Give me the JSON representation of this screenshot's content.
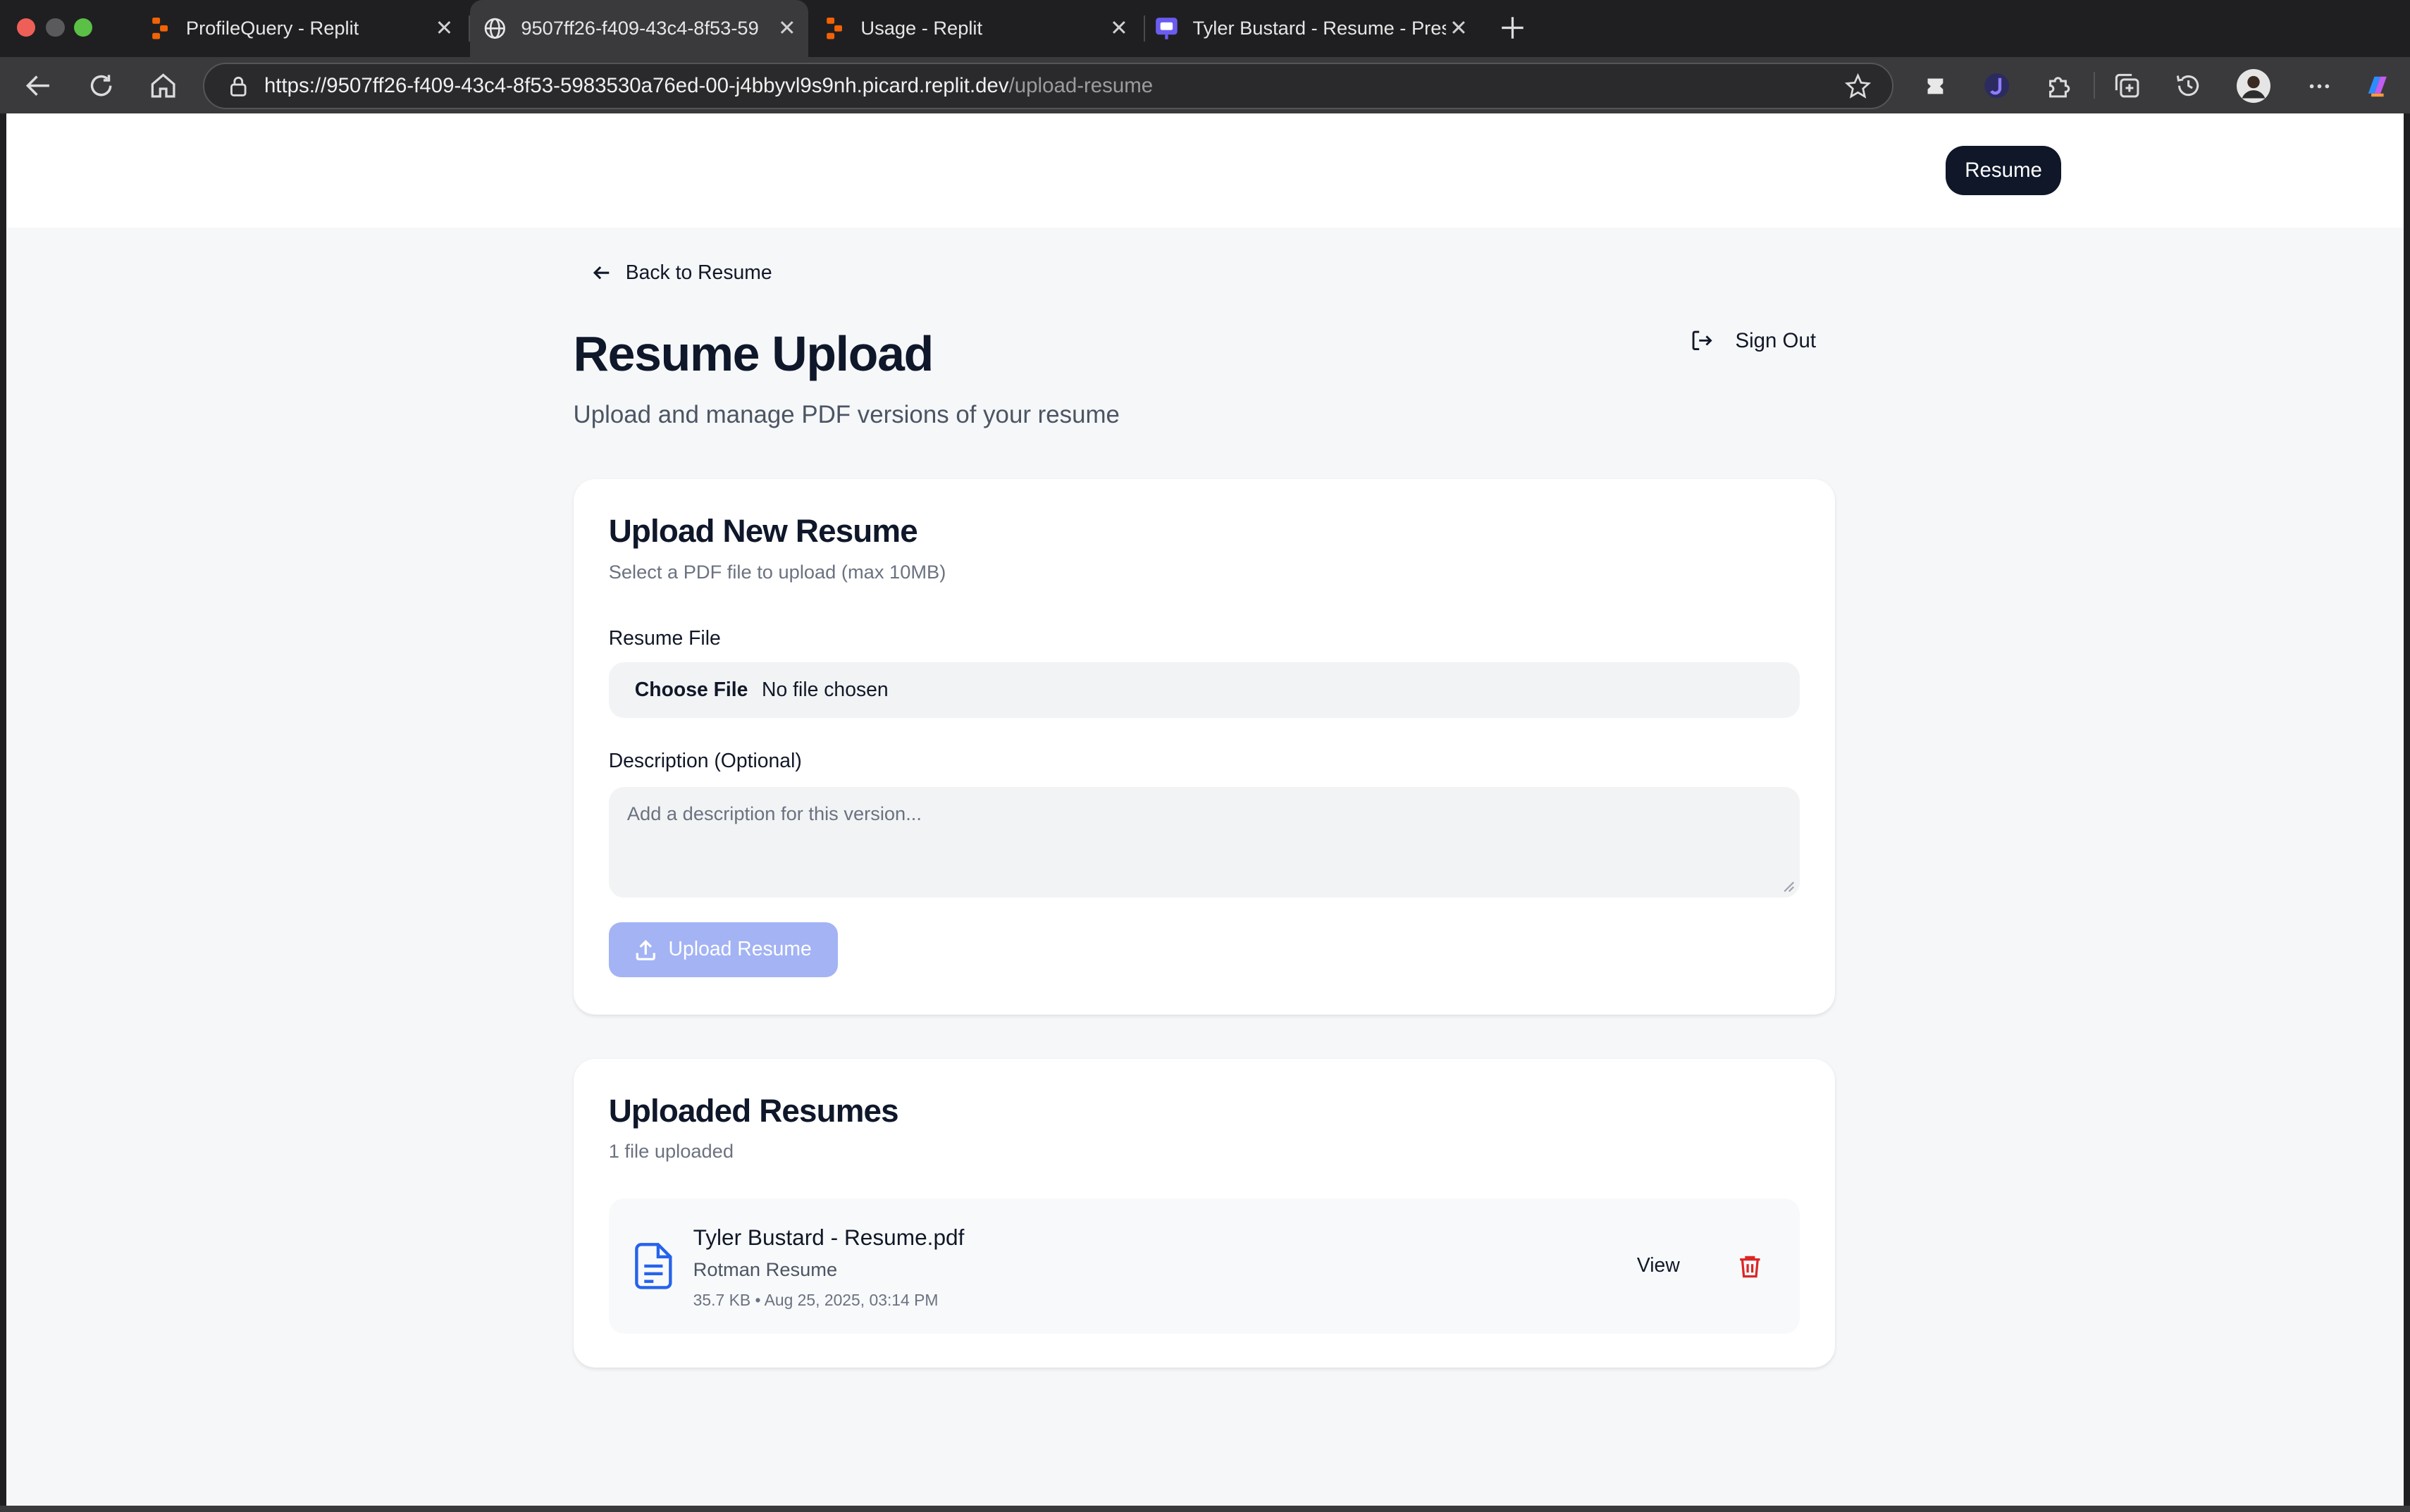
{
  "browser": {
    "tabs": [
      {
        "title": "ProfileQuery - Replit",
        "icon": "replit-icon"
      },
      {
        "title": "9507ff26-f409-43c4-8f53-59",
        "icon": "globe-icon",
        "active": true
      },
      {
        "title": "Usage - Replit",
        "icon": "replit-icon"
      },
      {
        "title": "Tyler Bustard - Resume - Prese",
        "icon": "presentation-icon"
      }
    ],
    "url_main": "https://9507ff26-f409-43c4-8f53-5983530a76ed-00-j4bbyvl9s9nh.picard.replit.dev",
    "url_path": "/upload-resume",
    "colors": {
      "chrome_bg": "#1f1f21",
      "tab_active": "#3a3a3d"
    }
  },
  "topnav": {
    "resume_button": "Resume"
  },
  "page": {
    "back_link": "Back to Resume",
    "title": "Resume Upload",
    "subtitle": "Upload and manage PDF versions of your resume",
    "sign_out": "Sign Out"
  },
  "upload_card": {
    "title": "Upload New Resume",
    "description": "Select a PDF file to upload (max 10MB)",
    "file_label": "Resume File",
    "choose_file": "Choose File",
    "no_file": "No file chosen",
    "desc_label": "Description (Optional)",
    "desc_placeholder": "Add a description for this version...",
    "upload_button": "Upload Resume",
    "colors": {
      "upload_button_bg": "#a3b3f4"
    }
  },
  "uploaded_card": {
    "title": "Uploaded Resumes",
    "count": "1 file uploaded",
    "files": [
      {
        "name": "Tyler Bustard - Resume.pdf",
        "description": "Rotman Resume",
        "meta": "35.7 KB • Aug 25, 2025, 03:14 PM",
        "view": "View",
        "icon": "file-text-icon"
      }
    ],
    "colors": {
      "file_icon": "#2563eb",
      "delete_icon": "#dc2626"
    }
  }
}
